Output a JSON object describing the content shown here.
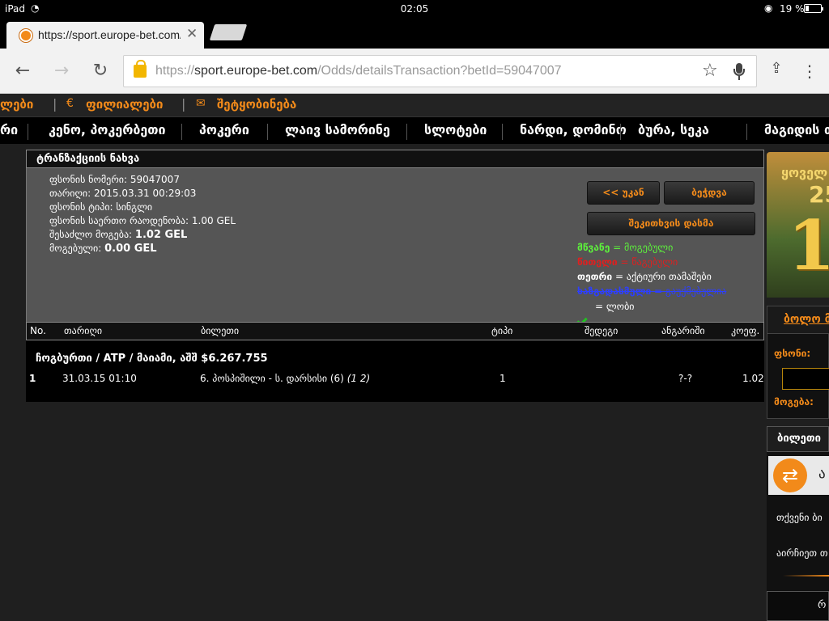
{
  "status_bar": {
    "device": "iPad",
    "time": "02:05",
    "battery": "19 %"
  },
  "tab": {
    "title": "https://sport.europe-bet.com/Odds/detailsTransaction?betId=59047007"
  },
  "address_bar": {
    "scheme": "https://",
    "host": "sport.europe-bet.com",
    "path": "/Odds/detailsTransaction?betId=59047007"
  },
  "site_top": {
    "link1": "ლები",
    "link2": "ფილიალები",
    "link3": "შეტყობინება"
  },
  "site_nav": [
    "რი",
    "კენო, პოკერბეთი",
    "პოკერი",
    "ლაივ სამორინე",
    "სლოტები",
    "ნარდი, დომინო",
    "ბურა, სეკა",
    "მაგიდის თ"
  ],
  "panel": {
    "title": "ტრანზაქციის ნახვა",
    "info": [
      {
        "label": "ფსონის ნომერი:",
        "value": "59047007"
      },
      {
        "label": "თარიღი:",
        "value": "2015.03.31 00:29:03"
      },
      {
        "label": "ფსონის ტიპი:",
        "value": "სინგლი"
      },
      {
        "label": "ფსონის საერთო რაოდენობა:",
        "value": "1.00 GEL"
      },
      {
        "label": "შესაძლო მოგება:",
        "value": "1.02 GEL"
      },
      {
        "label": "მოგებული:",
        "value": "0.00 GEL"
      }
    ],
    "buttons": {
      "back": "<< უკან",
      "print": "ბეჭდვა",
      "check": "შეკითხვის დასმა"
    },
    "legend": {
      "green_word": "მწვანე",
      "green_text": " = მოგებული",
      "red_word": "წითელი",
      "red_text": " = წაგებული",
      "white_word": "თეთრი",
      "white_text": " = აქტიური თამაშები",
      "blue_word": "ხაზგადასმული",
      "blue_text": " = გაუქმებულია",
      "check_text": "= ლობი"
    },
    "colors": {
      "green": "#5df03c",
      "red": "#e01f1f",
      "blue": "#2d3fff",
      "accent": "#f28a1a"
    }
  },
  "table": {
    "headers": {
      "no": "No.",
      "date": "თარიღი",
      "ticket": "ბილეთი",
      "type": "ტიპი",
      "result": "შედეგი",
      "score": "ანგარიში",
      "odds": "კოეფ."
    },
    "group": "ჩოგბურთი / ATP / მაიამი, აშშ $6.267.755",
    "rows": [
      {
        "no": "1",
        "date": "31.03.15 01:10",
        "event": "6. პოსპიშილი - ს. დარსისი (6)",
        "event_extra": "(1 2)",
        "type": "1",
        "result": "",
        "score": "?-?",
        "odds": "1.02"
      }
    ]
  },
  "sidebar": {
    "promo_top": "ყოველ",
    "promo_mid": "25",
    "promo_big": "1",
    "box1_title": "ბოლო მ",
    "bet_label": "ფსონი:",
    "win_label": "მოგება:",
    "box2_title": "ბილეთი",
    "strip_text": "ა",
    "text1": "თქვენი ბი",
    "text2": "აირჩიეთ თ",
    "footer": "რ"
  }
}
